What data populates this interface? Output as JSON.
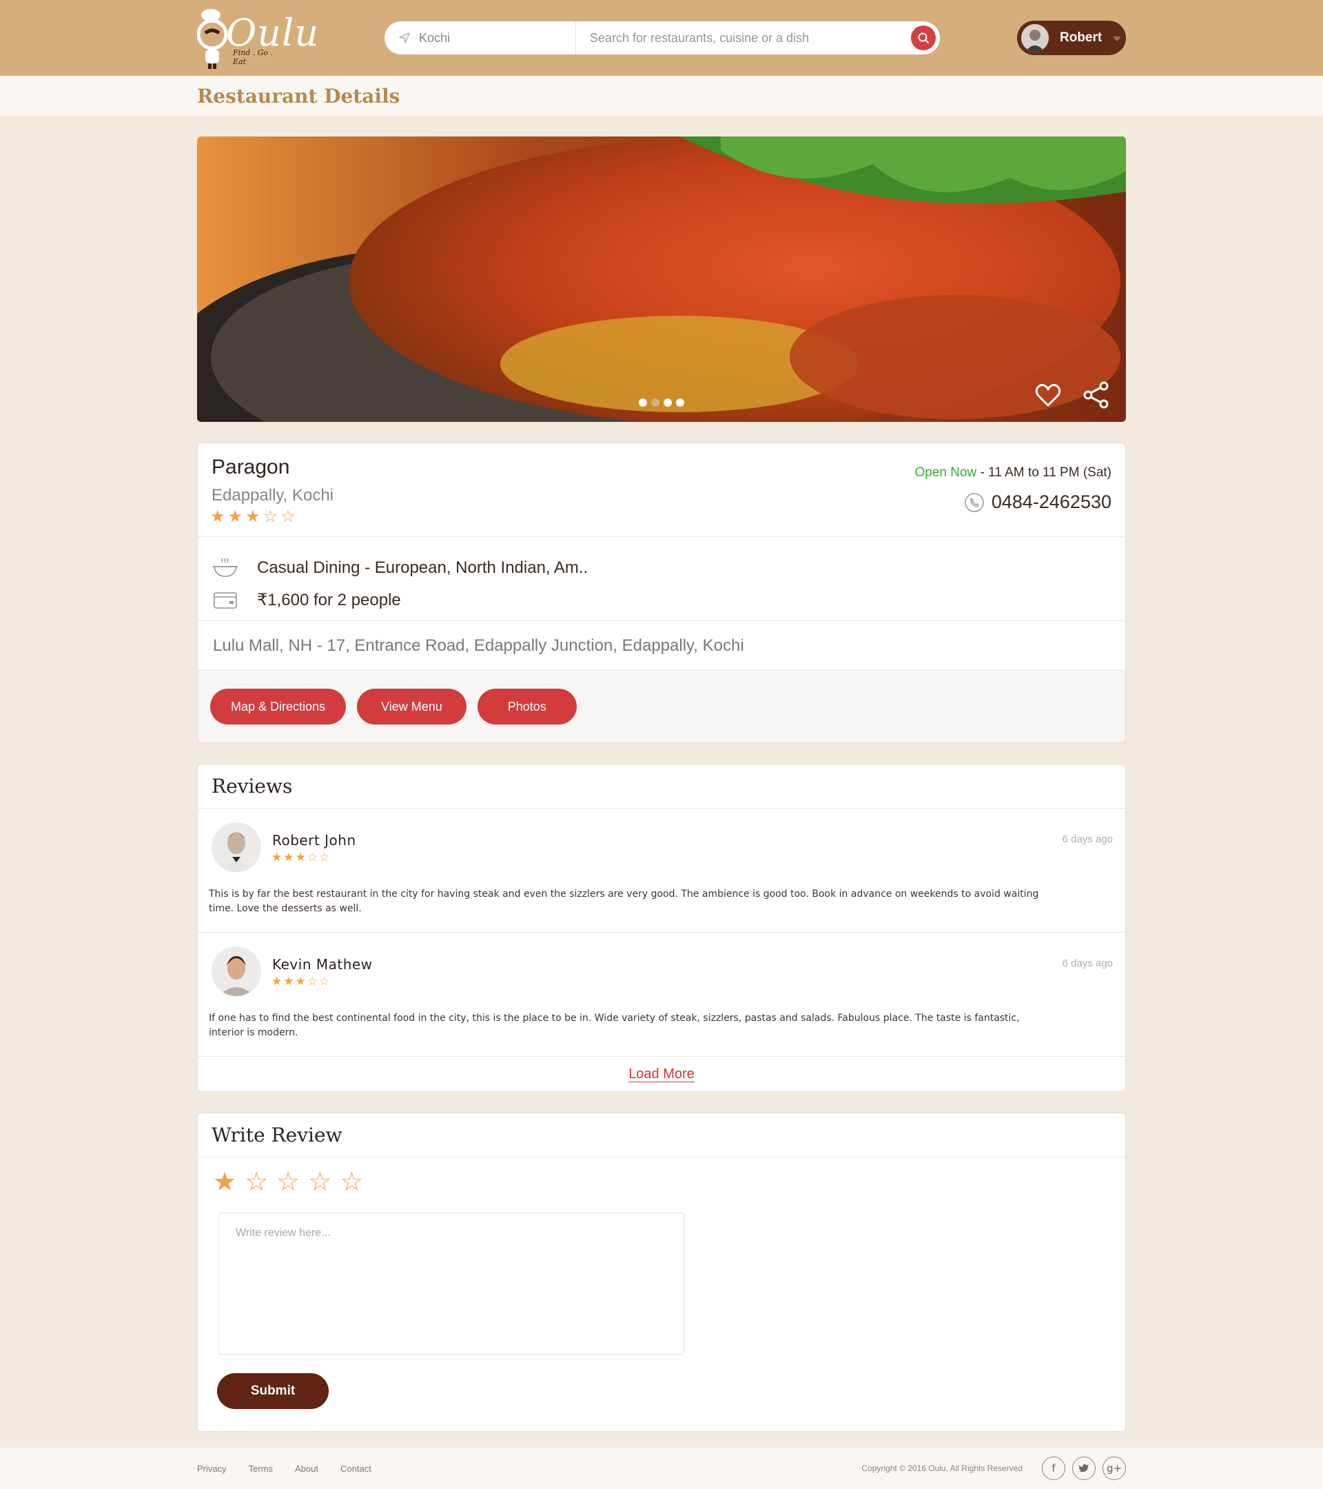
{
  "header": {
    "logo_text": "Oulu",
    "logo_tagline": "Find . Go . Eat",
    "location_value": "Kochi",
    "search_placeholder": "Search for restaurants, cuisine or a dish",
    "user_name": "Robert",
    "colors": {
      "header_bg": "#d6ae7c",
      "search_btn": "#d43f3f",
      "user_pill": "#612a17"
    }
  },
  "page": {
    "title": "Restaurant Details"
  },
  "hero": {
    "slides_total": 4,
    "active_slide": 2,
    "icons": [
      "heart-icon",
      "share-icon"
    ]
  },
  "restaurant": {
    "name": "Paragon",
    "location": "Edappally, Kochi",
    "rating": 3,
    "rating_max": 5,
    "open_status": "Open Now",
    "hours": " - 11 AM to 11 PM (Sat)",
    "phone": "0484-2462530",
    "cuisine": "Casual Dining - European, North Indian, Am..",
    "cost": "₹1,600 for 2 people",
    "address": "Lulu Mall, NH - 17, Entrance Road, Edappally Junction, Edappally, Kochi",
    "buttons": {
      "map": "Map & Directions",
      "menu": "View Menu",
      "photos": "Photos"
    },
    "colors": {
      "open": "#3aa43a",
      "button": "#d23c3c",
      "star": "#f0a342"
    }
  },
  "reviews": {
    "title": "Reviews",
    "items": [
      {
        "name": "Robert John",
        "rating": 3,
        "date": "6 days ago",
        "text": "This is by far the best restaurant in the city for having steak and even the sizzlers are very good. The ambience is good too. Book in advance on weekends to avoid waiting time. Love the desserts as well."
      },
      {
        "name": "Kevin Mathew",
        "rating": 3,
        "date": "6 days ago",
        "text": "If one has to find the best continental food in the city, this is the place to be in. Wide variety of steak, sizzlers, pastas and salads. Fabulous place. The taste is fantastic, interior is modern."
      }
    ],
    "load_more": "Load More"
  },
  "write_review": {
    "title": "Write Review",
    "selected_rating": 1,
    "rating_max": 5,
    "placeholder": "Write review here...",
    "submit": "Submit"
  },
  "footer": {
    "links": [
      "Privacy",
      "Terms",
      "About",
      "Contact"
    ],
    "copyright": "Copyright © 2016 Oulu. All Rights Reserved",
    "social": [
      "f",
      "t",
      "g+"
    ]
  }
}
